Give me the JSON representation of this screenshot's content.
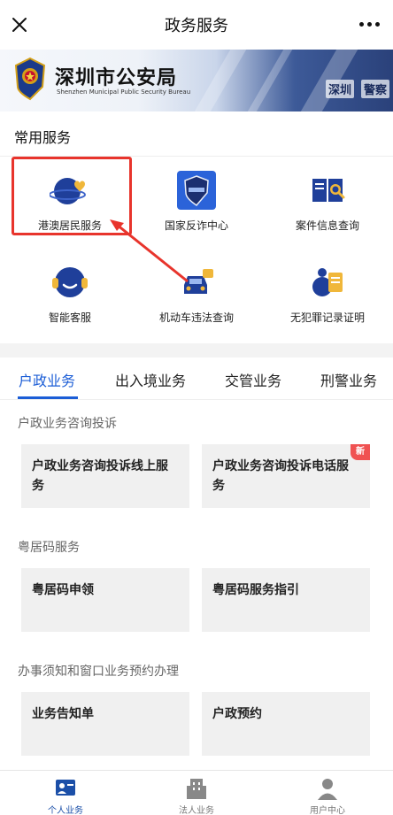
{
  "header": {
    "title": "政务服务",
    "close_icon": "close-icon",
    "more_icon": "more-icon"
  },
  "banner": {
    "org_name": "深圳市公安局",
    "org_name_en": "Shenzhen Municipal Public Security Bureau",
    "sign_texts": [
      "深圳",
      "警察"
    ],
    "emblem_icon": "police-emblem-icon"
  },
  "common_services": {
    "title": "常用服务",
    "items": [
      {
        "label": "港澳居民服务",
        "icon": "globe-heart-icon"
      },
      {
        "label": "国家反诈中心",
        "icon": "anti-fraud-shield-icon"
      },
      {
        "label": "案件信息查询",
        "icon": "book-search-icon"
      },
      {
        "label": "智能客服",
        "icon": "headset-robot-icon"
      },
      {
        "label": "机动车违法查询",
        "icon": "car-icon"
      },
      {
        "label": "无犯罪记录证明",
        "icon": "certificate-icon"
      }
    ],
    "highlight_color": "#e8342c"
  },
  "tabs": {
    "items": [
      "户政业务",
      "出入境业务",
      "交管业务",
      "刑警业务"
    ],
    "active": "户政业务",
    "accent_color": "#1b5dd6"
  },
  "sections": [
    {
      "title": "户政业务咨询投诉",
      "cards": [
        {
          "label": "户政业务咨询投诉线上服务",
          "badge": ""
        },
        {
          "label": "户政业务咨询投诉电话服务",
          "badge": "新"
        }
      ]
    },
    {
      "title": "粤居码服务",
      "cards": [
        {
          "label": "粤居码申领",
          "badge": ""
        },
        {
          "label": "粤居码服务指引",
          "badge": ""
        }
      ]
    },
    {
      "title": "办事须知和窗口业务预约办理",
      "cards": [
        {
          "label": "业务告知单",
          "badge": ""
        },
        {
          "label": "户政预约",
          "badge": ""
        }
      ]
    }
  ],
  "bottom_nav": {
    "items": [
      {
        "label": "个人业务",
        "icon": "personal-id-icon",
        "active": true
      },
      {
        "label": "法人业务",
        "icon": "building-icon",
        "active": false
      },
      {
        "label": "用户中心",
        "icon": "user-icon",
        "active": false
      }
    ]
  }
}
